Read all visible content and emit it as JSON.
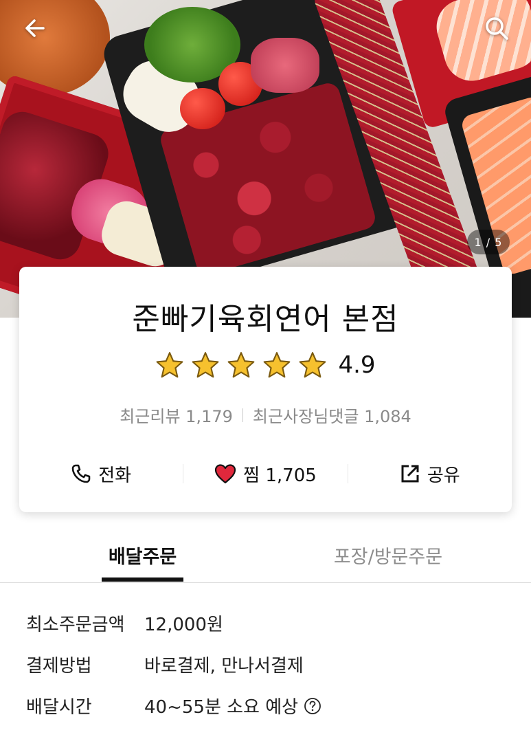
{
  "hero": {
    "page_counter": "1 / 5",
    "current_page": 1,
    "total_pages": 5
  },
  "icons": {
    "back": "back-arrow-icon",
    "search": "search-icon",
    "star": "star-icon",
    "phone": "phone-icon",
    "heart": "heart-icon",
    "share": "share-icon",
    "help": "question-circle-icon"
  },
  "store": {
    "name": "준빠기육회연어 본점",
    "rating": "4.9",
    "stars_filled": 5,
    "stars_total": 5,
    "recent_reviews_label": "최근리뷰 1,179",
    "owner_replies_label": "최근사장님댓글 1,084"
  },
  "actions": {
    "call_label": "전화",
    "like_label": "찜 1,705",
    "share_label": "공유"
  },
  "tabs": {
    "delivery_label": "배달주문",
    "pickup_label": "포장/방문주문",
    "active": "배달주문"
  },
  "info": {
    "min_order_label": "최소주문금액",
    "min_order_value": "12,000원",
    "payment_label": "결제방법",
    "payment_value": "바로결제, 만나서결제",
    "delivery_time_label": "배달시간",
    "delivery_time_value": "40~55분 소요 예상"
  },
  "colors": {
    "star": "#F6C12E",
    "star_stroke": "#7a5a10",
    "heart": "#E0283C",
    "text_primary": "#111111",
    "text_muted": "#8A8A8A"
  }
}
